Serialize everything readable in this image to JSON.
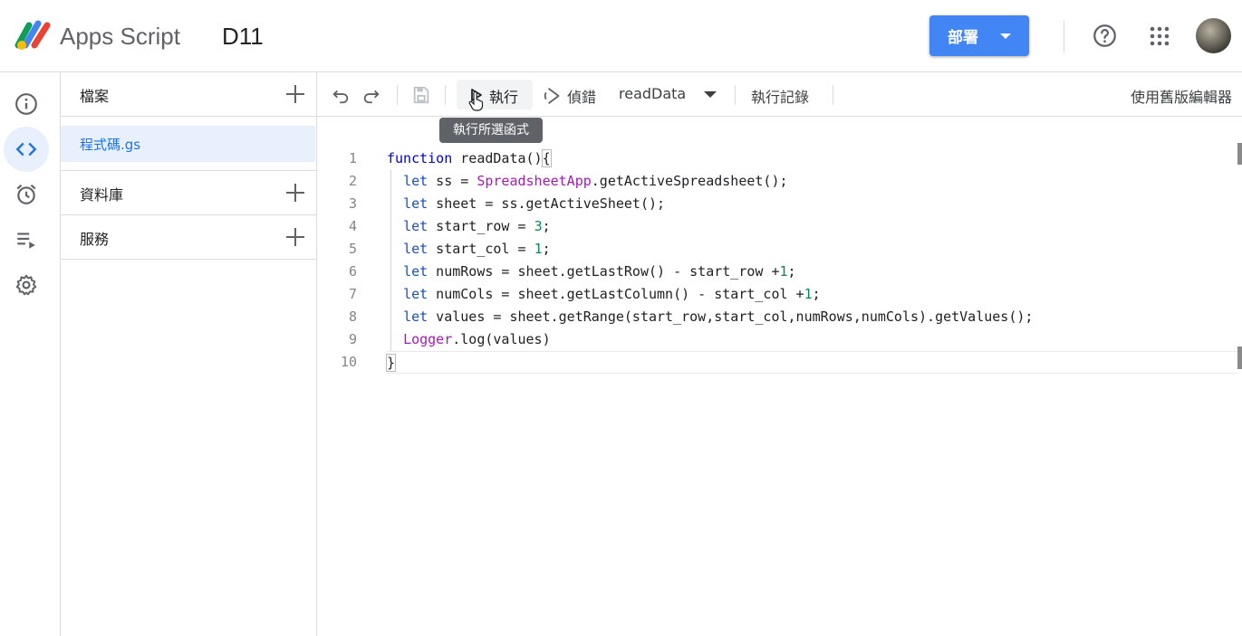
{
  "header": {
    "app_name": "Apps Script",
    "project_name": "D11",
    "deploy_label": "部署"
  },
  "files_panel": {
    "files_section": "檔案",
    "file_name": "程式碼.gs",
    "library_section": "資料庫",
    "services_section": "服務"
  },
  "toolbar": {
    "run_label": "執行",
    "debug_label": "偵錯",
    "function_name": "readData",
    "log_label": "執行記錄",
    "legacy_label": "使用舊版編輯器"
  },
  "tooltip": "執行所選函式",
  "editor": {
    "line_numbers": [
      "1",
      "2",
      "3",
      "4",
      "5",
      "6",
      "7",
      "8",
      "9",
      "10"
    ],
    "lines": [
      [
        {
          "t": "function",
          "c": "kw"
        },
        {
          "t": " readData()",
          "c": ""
        },
        {
          "t": "{",
          "c": "brace"
        }
      ],
      [
        {
          "t": "  ",
          "c": "indent"
        },
        {
          "t": "let",
          "c": "kw2"
        },
        {
          "t": " ss = ",
          "c": ""
        },
        {
          "t": "SpreadsheetApp",
          "c": "cls"
        },
        {
          "t": ".getActiveSpreadsheet();",
          "c": ""
        }
      ],
      [
        {
          "t": "  ",
          "c": "indent"
        },
        {
          "t": "let",
          "c": "kw2"
        },
        {
          "t": " sheet = ss.getActiveSheet();",
          "c": ""
        }
      ],
      [
        {
          "t": "  ",
          "c": "indent"
        },
        {
          "t": "let",
          "c": "kw2"
        },
        {
          "t": " start_row = ",
          "c": ""
        },
        {
          "t": "3",
          "c": "num"
        },
        {
          "t": ";",
          "c": ""
        }
      ],
      [
        {
          "t": "  ",
          "c": "indent"
        },
        {
          "t": "let",
          "c": "kw2"
        },
        {
          "t": " start_col = ",
          "c": ""
        },
        {
          "t": "1",
          "c": "num"
        },
        {
          "t": ";",
          "c": ""
        }
      ],
      [
        {
          "t": "  ",
          "c": "indent"
        },
        {
          "t": "let",
          "c": "kw2"
        },
        {
          "t": " numRows = sheet.getLastRow() - start_row +",
          "c": ""
        },
        {
          "t": "1",
          "c": "num"
        },
        {
          "t": ";",
          "c": ""
        }
      ],
      [
        {
          "t": "  ",
          "c": "indent"
        },
        {
          "t": "let",
          "c": "kw2"
        },
        {
          "t": " numCols = sheet.getLastColumn() - start_col +",
          "c": ""
        },
        {
          "t": "1",
          "c": "num"
        },
        {
          "t": ";",
          "c": ""
        }
      ],
      [
        {
          "t": "  ",
          "c": "indent"
        },
        {
          "t": "let",
          "c": "kw2"
        },
        {
          "t": " values = sheet.getRange(start_row,start_col,numRows,numCols).getValues();",
          "c": ""
        }
      ],
      [
        {
          "t": "  ",
          "c": "indent"
        },
        {
          "t": "Logger",
          "c": "cls"
        },
        {
          "t": ".log(values)",
          "c": ""
        }
      ],
      [
        {
          "t": "}",
          "c": "brace"
        }
      ]
    ],
    "current_line": 10
  },
  "colors": {
    "accent": "#4285f4",
    "selected_bg": "#e8f0fe",
    "link": "#1a73e8"
  }
}
